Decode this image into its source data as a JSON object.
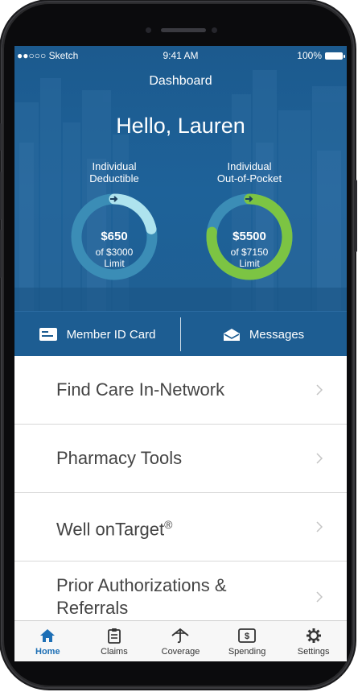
{
  "status_bar": {
    "carrier": "●●○○○ Sketch",
    "time": "9:41 AM",
    "battery": "100%"
  },
  "header": {
    "title": "Dashboard",
    "greeting": "Hello, Lauren"
  },
  "gauges": [
    {
      "label_line1": "Individual",
      "label_line2": "Deductible",
      "amount": "$650",
      "of_text": "of $3000",
      "limit_text": "Limit",
      "fraction": 0.2167,
      "color": "#aee3ee"
    },
    {
      "label_line1": "Individual",
      "label_line2": "Out-of-Pocket",
      "amount": "$5500",
      "of_text": "of $7150",
      "limit_text": "Limit",
      "fraction": 0.769,
      "color": "#7cc443"
    }
  ],
  "quick_actions": {
    "member_id": "Member ID Card",
    "messages": "Messages"
  },
  "menu": [
    {
      "label": "Find Care In-Network"
    },
    {
      "label": "Pharmacy Tools"
    },
    {
      "label": "Well onTarget",
      "sup": "®"
    },
    {
      "label": "Prior Authorizations & Referrals"
    }
  ],
  "tabs": [
    {
      "label": "Home",
      "icon": "home-icon",
      "active": true
    },
    {
      "label": "Claims",
      "icon": "clipboard-icon"
    },
    {
      "label": "Coverage",
      "icon": "umbrella-icon"
    },
    {
      "label": "Spending",
      "icon": "dollar-icon"
    },
    {
      "label": "Settings",
      "icon": "gear-icon"
    }
  ],
  "colors": {
    "primary": "#1d5d92",
    "active_tab": "#1d6fb5",
    "ring_track": "#3b8db6"
  }
}
